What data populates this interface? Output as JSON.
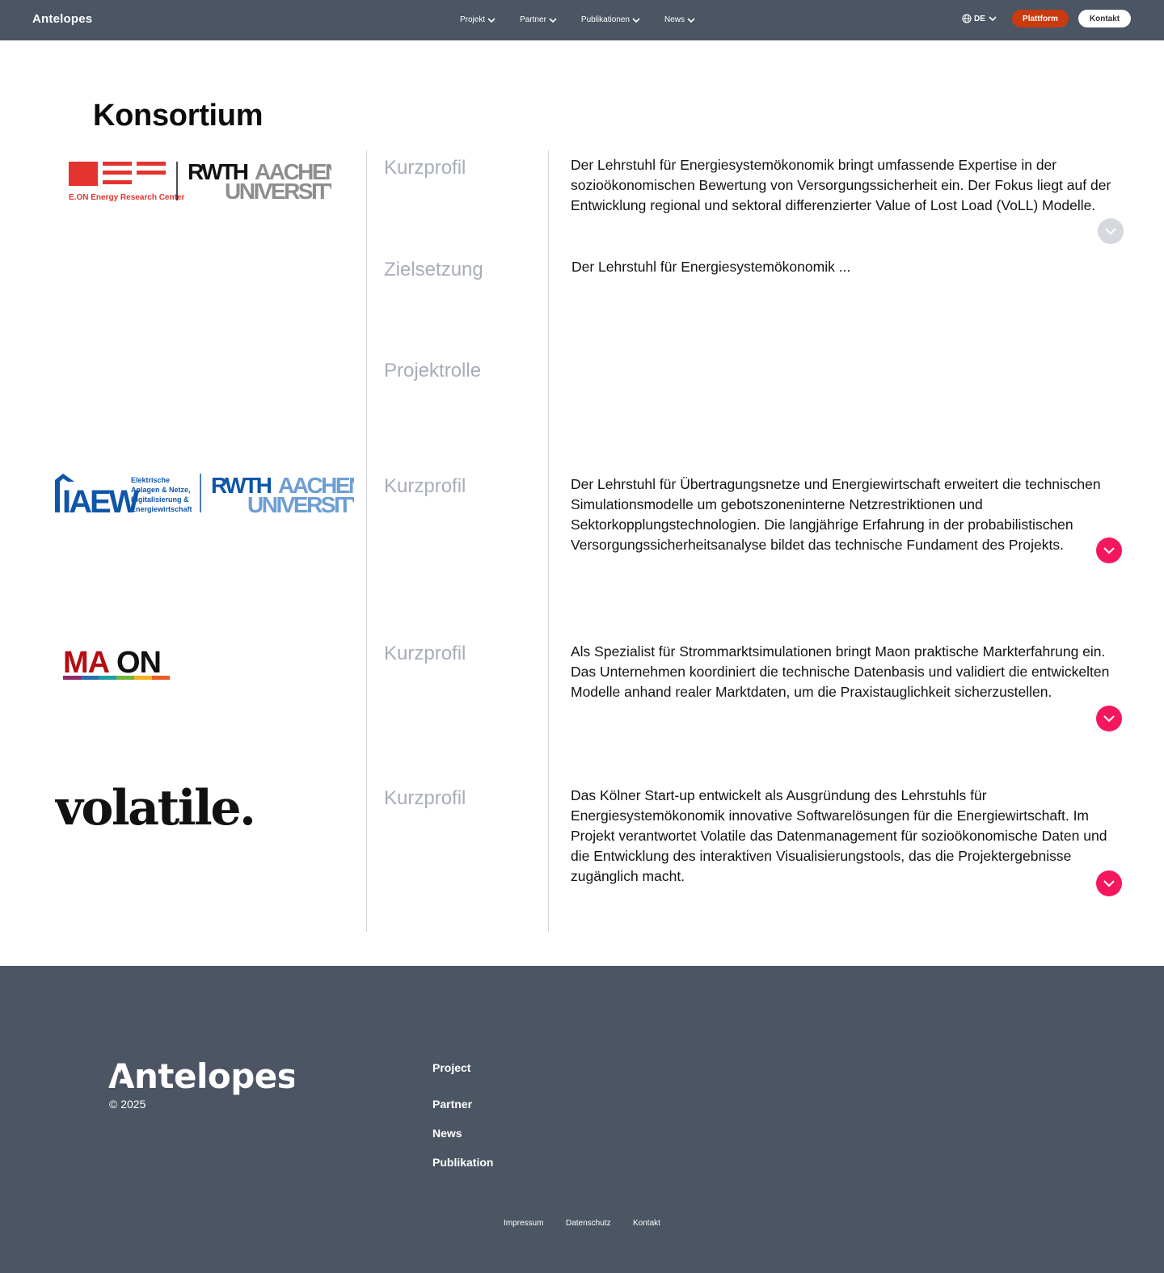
{
  "header": {
    "brand": "Antelopes",
    "nav": [
      {
        "label": "Projekt"
      },
      {
        "label": "Partner"
      },
      {
        "label": "Publikationen"
      },
      {
        "label": "News"
      }
    ],
    "language": "DE",
    "platform_label": "Plattform",
    "contact_label": "Kontakt"
  },
  "main": {
    "title": "Konsortium",
    "partners": [
      {
        "logo": {
          "label": "E.ON Energy Research Center",
          "text": "RWTH AACHEN UNIVERSITY",
          "accent": "#e3342f"
        },
        "sections": [
          {
            "label": "Kurzprofil",
            "text": "Der Lehrstuhl für Energiesystemökonomik bringt umfassende Expertise in der sozioökonomischen Bewertung von Versorgungssicherheit ein. Der Fokus liegt auf der Entwicklung regional und sektoral differenzierter Value of Lost Load (VoLL) Modelle."
          },
          {
            "label": "Zielsetzung",
            "text": "Der Lehrstuhl für Energiesystemökonomik ..."
          },
          {
            "label": "Projektrolle",
            "text": ""
          }
        ]
      },
      {
        "logo": {
          "label": "IAEW",
          "subtitle": "Elektrische Anlagen & Netze, Digitalisierung & Energiewirtschaft",
          "text": "RWTH AACHEN UNIVERSITY",
          "accent": "#0e56a8"
        },
        "sections": [
          {
            "label": "Kurzprofil",
            "text": "Der Lehrstuhl für Übertragungsnetze und Energiewirtschaft erweitert die technischen Simulationsmodelle um gebotszoneninterne Netzrestriktionen und Sektorkopplungstechnologien. Die langjährige Erfahrung in der probabilistischen Versorgungssicherheitsanalyse bildet das technische Fundament des Projekts."
          }
        ]
      },
      {
        "logo": {
          "label": "MAON",
          "accent": "#b50d12"
        },
        "sections": [
          {
            "label": "Kurzprofil",
            "text": "Als Spezialist für Strommarktsimulationen bringt Maon praktische Markterfahrung ein. Das Unternehmen koordiniert die technische Datenbasis und validiert die entwickelten Modelle anhand realer Marktdaten, um die Praxistauglichkeit sicherzustellen."
          }
        ]
      },
      {
        "logo": {
          "label": "volatile."
        },
        "sections": [
          {
            "label": "Kurzprofil",
            "text": "Das Kölner Start-up entwickelt als Ausgründung des Lehrstuhls für Energiesystemökonomik innovative Softwarelösungen für die Energiewirtschaft. Im Projekt verantwortet Volatile das Datenmanagement für sozioökonomische Daten und die Entwicklung des interaktiven Visualisierungstools, das die Projektergebnisse zugänglich macht."
          }
        ]
      }
    ]
  },
  "footer": {
    "brand": "Antelopes",
    "copyright": "© 2025",
    "links": [
      "Project",
      "Partner",
      "News",
      "Publikation"
    ],
    "legal": [
      "Impressum",
      "Datenschutz",
      "Kontakt"
    ]
  },
  "colors": {
    "header_bg": "#4c5563",
    "accent_red": "#f5175d",
    "platform_orange": "#c93a0e",
    "muted_label": "#a7adb7"
  }
}
